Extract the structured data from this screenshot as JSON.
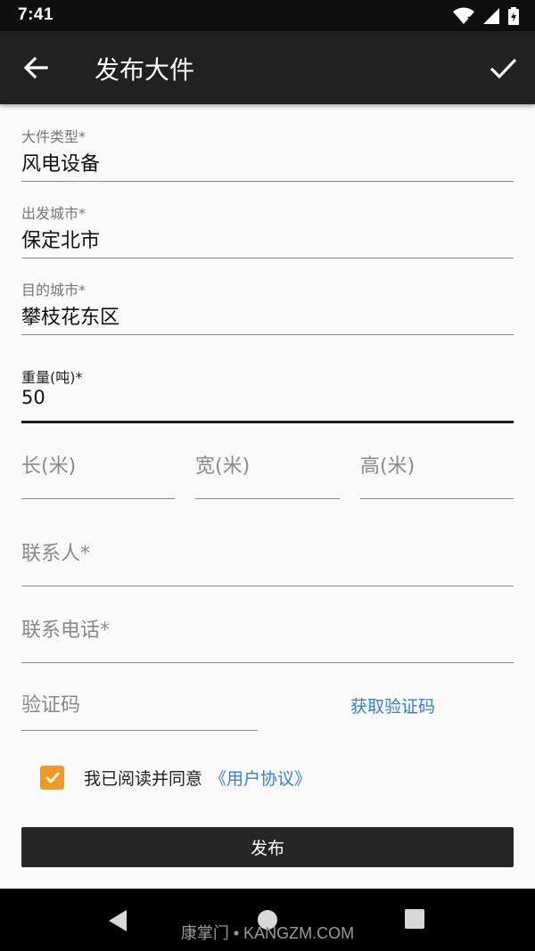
{
  "status_bar": {
    "time": "7:41",
    "icons": [
      "wifi-icon",
      "signal-icon",
      "battery-icon"
    ]
  },
  "app_bar": {
    "title": "发布大件",
    "back_icon": "arrow-left-icon",
    "confirm_icon": "check-icon"
  },
  "form": {
    "cargo_type": {
      "label": "大件类型*",
      "value": "风电设备"
    },
    "from_city": {
      "label": "出发城市*",
      "value": "保定北市"
    },
    "to_city": {
      "label": "目的城市*",
      "value": "攀枝花东区"
    },
    "weight": {
      "label": "重量(吨)*",
      "value": "50"
    },
    "length": {
      "placeholder": "长(米)"
    },
    "width": {
      "placeholder": "宽(米)"
    },
    "height": {
      "placeholder": "高(米)"
    },
    "contact": {
      "placeholder": "联系人*"
    },
    "phone": {
      "placeholder": "联系电话*"
    },
    "code": {
      "placeholder": "验证码"
    },
    "get_code_label": "获取验证码",
    "agree_text": "我已阅读并同意",
    "agree_link": "《用户协议》",
    "agree_checked": true,
    "submit_label": "发布"
  },
  "colors": {
    "accent": "#f39a1e",
    "link": "#2f80e0",
    "app_bar": "#212121"
  },
  "watermark": "康掌门 • KANGZM.COM"
}
